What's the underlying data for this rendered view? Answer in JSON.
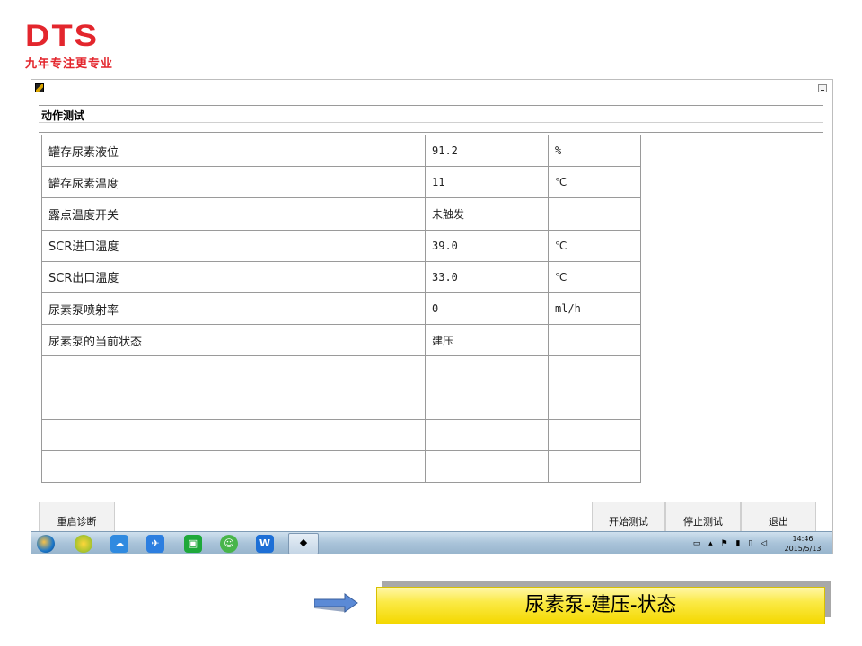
{
  "logo": {
    "mark": "DTS",
    "tagline": "九年专注更专业"
  },
  "window": {
    "section_title": "动作测试",
    "rows": [
      {
        "name": "罐存尿素液位",
        "value": "91.2",
        "unit": "%"
      },
      {
        "name": "罐存尿素温度",
        "value": "11",
        "unit": "℃"
      },
      {
        "name": "露点温度开关",
        "value": "未触发",
        "unit": ""
      },
      {
        "name": "SCR进口温度",
        "value": "39.0",
        "unit": "℃"
      },
      {
        "name": "SCR出口温度",
        "value": "33.0",
        "unit": "℃"
      },
      {
        "name": "尿素泵喷射率",
        "value": "0",
        "unit": "ml/h"
      },
      {
        "name": "尿素泵的当前状态",
        "value": "建压",
        "unit": ""
      },
      {
        "name": "",
        "value": "",
        "unit": ""
      },
      {
        "name": "",
        "value": "",
        "unit": ""
      },
      {
        "name": "",
        "value": "",
        "unit": ""
      },
      {
        "name": "",
        "value": "",
        "unit": ""
      }
    ],
    "buttons": {
      "restart": "重启诊断",
      "start_test": "开始测试",
      "stop_test": "停止测试",
      "exit": "退出"
    }
  },
  "taskbar": {
    "clock_time": "14:46",
    "clock_date": "2015/5/13"
  },
  "caption": {
    "text": "尿素泵-建压-状态"
  },
  "colors": {
    "brand_red": "#e3262d",
    "caption_yellow": "#f7e234",
    "arrow_blue": "#4a7bc8"
  }
}
